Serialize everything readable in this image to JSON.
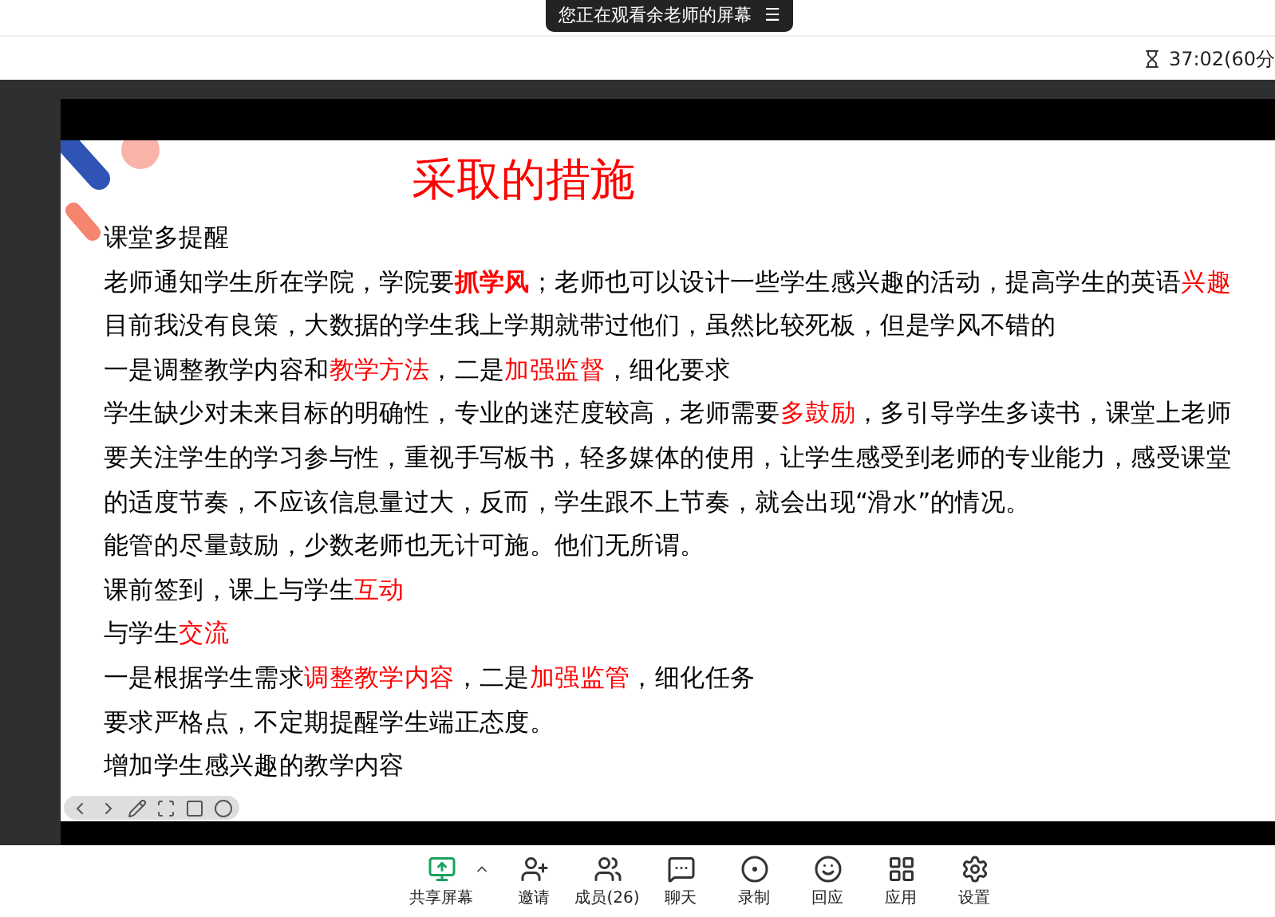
{
  "banner": {
    "text": "您正在观看余老师的屏幕",
    "menu_glyph": "☰"
  },
  "timer": {
    "text": "37:02(60分"
  },
  "slide": {
    "title": "采取的措施",
    "lines": [
      [
        {
          "text": "课堂多提醒",
          "kind": "plain"
        }
      ],
      [
        {
          "text": "老师通知学生所在学院，学院要",
          "kind": "plain"
        },
        {
          "text": "抓学风",
          "kind": "strong"
        },
        {
          "text": "；老师也可以设计一些学生感兴趣的活动，提高学生的英语",
          "kind": "plain"
        },
        {
          "text": "兴趣",
          "kind": "accent"
        }
      ],
      [
        {
          "text": "目前我没有良策，大数据的学生我上学期就带过他们，虽然比较死板，但是学风不错的",
          "kind": "plain"
        }
      ],
      [
        {
          "text": "一是调整教学内容和",
          "kind": "plain"
        },
        {
          "text": "教学方法",
          "kind": "accent"
        },
        {
          "text": "，二是",
          "kind": "plain"
        },
        {
          "text": "加强监督",
          "kind": "accent"
        },
        {
          "text": "，细化要求",
          "kind": "plain"
        }
      ],
      [
        {
          "text": "学生缺少对未来目标的明确性，专业的迷茫度较高，老师需要",
          "kind": "plain"
        },
        {
          "text": "多鼓励",
          "kind": "accent"
        },
        {
          "text": "，多引导学生多读书，课堂上老师",
          "kind": "plain"
        }
      ],
      [
        {
          "text": "要关注学生的学习参与性，重视手写板书，轻多媒体的使用，让学生感受到老师的专业能力，感受课堂",
          "kind": "plain"
        }
      ],
      [
        {
          "text": "的适度节奏，不应该信息量过大，反而，学生跟不上节奏，就会出现“滑水”的情况。",
          "kind": "plain"
        }
      ],
      [
        {
          "text": "能管的尽量鼓励，少数老师也无计可施。他们无所谓。",
          "kind": "plain"
        }
      ],
      [
        {
          "text": "课前签到，课上与学生",
          "kind": "plain"
        },
        {
          "text": "互动",
          "kind": "accent"
        }
      ],
      [
        {
          "text": "与学生",
          "kind": "plain"
        },
        {
          "text": "交流",
          "kind": "accent"
        }
      ],
      [
        {
          "text": "一是根据学生需求",
          "kind": "plain"
        },
        {
          "text": "调整教学内容",
          "kind": "accent"
        },
        {
          "text": "，二是",
          "kind": "plain"
        },
        {
          "text": "加强监管",
          "kind": "accent"
        },
        {
          "text": "，细化任务",
          "kind": "plain"
        }
      ],
      [
        {
          "text": "要求严格点，不定期提醒学生端正态度。",
          "kind": "plain"
        }
      ],
      [
        {
          "text": "增加学生感兴趣的教学内容",
          "kind": "plain"
        }
      ]
    ]
  },
  "toolbar": [
    {
      "label": "共享屏幕",
      "kind": "share"
    },
    {
      "label": "邀请",
      "kind": "invite"
    },
    {
      "label": "成员(26)",
      "kind": "members"
    },
    {
      "label": "聊天",
      "kind": "chat"
    },
    {
      "label": "录制",
      "kind": "record"
    },
    {
      "label": "回应",
      "kind": "reaction"
    },
    {
      "label": "应用",
      "kind": "apps"
    },
    {
      "label": "设置",
      "kind": "settings"
    }
  ]
}
